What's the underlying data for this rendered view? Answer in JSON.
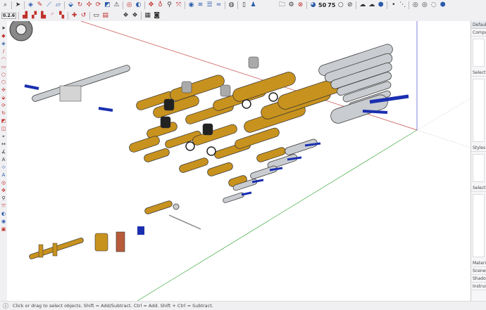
{
  "toolbar_top": {
    "icons": [
      "select-arrow",
      "eraser",
      "pencil",
      "line",
      "rectangle",
      "push-pull",
      "follow-me",
      "move",
      "rotate",
      "scale",
      "tape-measure",
      "orbit",
      "pan",
      "zoom",
      "zoom-extents",
      "layers",
      "styles",
      "scenes",
      "account",
      "new",
      "profile",
      "open-folder",
      "settings",
      "close",
      "display",
      "50",
      "75",
      "xray",
      "shade",
      "cloud-upload",
      "cloud-download",
      "component",
      "point",
      "line-dash",
      "solid1",
      "solid2",
      "solid3",
      "solid4"
    ],
    "label_50": "50",
    "label_75": "75"
  },
  "toolbar_second": {
    "counter": "0.2.6"
  },
  "tray": {
    "title": "Default Tray",
    "sections": [
      "Components",
      "Select",
      "Styles",
      "Select"
    ],
    "collapsed": [
      "Materials",
      "Scenes",
      "Shadows",
      "Instructor"
    ]
  },
  "status": {
    "message": "Click or drag to select objects. Shift = Add/Subtract. Ctrl = Add. Shift + Ctrl = Subtract."
  },
  "colors": {
    "brass": "#c8921e",
    "steel": "#c9ccd0",
    "handle": "#1a2fb0",
    "axis_red": "#c84a4a",
    "axis_green": "#3faa3f",
    "axis_blue": "#4a4ad0"
  }
}
